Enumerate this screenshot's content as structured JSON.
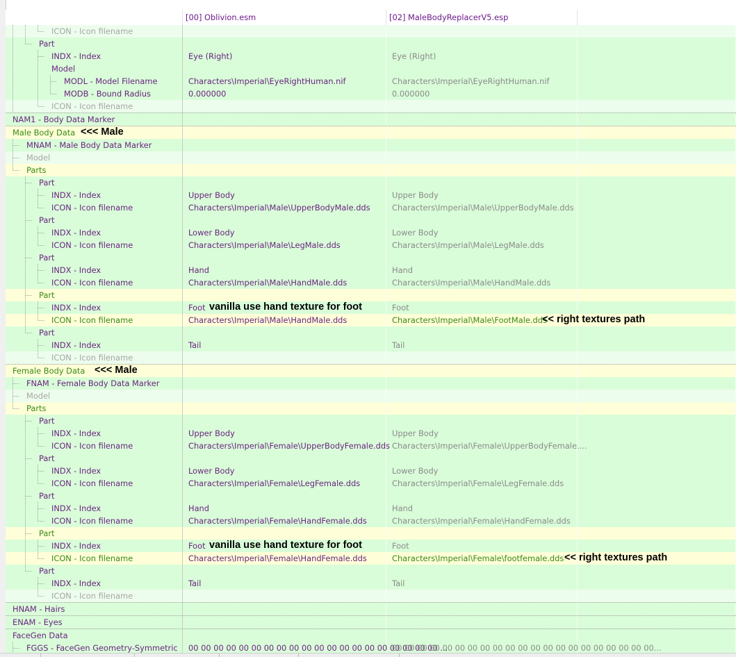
{
  "columns": [
    "",
    "[00] Oblivion.esm",
    "[02] MaleBodyReplacerV5.esp",
    ""
  ],
  "colors": {
    "green_bg": "#d9fdd9",
    "light_green_bg": "#edfded",
    "yellow_bg": "#fefed8",
    "conflict_text": "#3c8a18",
    "field_text": "#6a2480"
  },
  "rows": [
    {
      "depth": 3,
      "label": "ICON - Icon filename",
      "labelStyle": "grey",
      "bg": "lg",
      "lines": [
        1,
        1,
        0
      ],
      "elbow": 1,
      "v1": "",
      "v2": ""
    },
    {
      "depth": 2,
      "label": "Part",
      "labelStyle": "purple",
      "bg": "g",
      "lines": [
        1,
        0
      ],
      "elbow": 1,
      "v1": "",
      "v2": ""
    },
    {
      "depth": 3,
      "label": "INDX - Index",
      "labelStyle": "purple",
      "bg": "g",
      "lines": [
        1,
        0,
        1
      ],
      "elbow": 1,
      "v1": "Eye (Right)",
      "v2": "Eye (Right)"
    },
    {
      "depth": 3,
      "label": "Model",
      "labelStyle": "purple",
      "bg": "g",
      "lines": [
        1,
        0,
        1
      ],
      "elbow": 0,
      "v1": "",
      "v2": ""
    },
    {
      "depth": 4,
      "label": "MODL - Model Filename",
      "labelStyle": "purple",
      "bg": "g",
      "lines": [
        1,
        0,
        1,
        1
      ],
      "elbow": 1,
      "v1": "Characters\\Imperial\\EyeRightHuman.nif",
      "v2": "Characters\\Imperial\\EyeRightHuman.nif"
    },
    {
      "depth": 4,
      "label": "MODB - Bound Radius",
      "labelStyle": "purple",
      "bg": "g",
      "lines": [
        1,
        0,
        1,
        0
      ],
      "elbow": 1,
      "v1": "0.000000",
      "v2": "0.000000"
    },
    {
      "depth": 3,
      "label": "ICON - Icon filename",
      "labelStyle": "grey",
      "bg": "lg",
      "lines": [
        1,
        0,
        0
      ],
      "elbow": 1,
      "v1": "",
      "v2": ""
    },
    {
      "depth": 0,
      "label": "NAM1 - Body Data Marker",
      "labelStyle": "purple",
      "bg": "g",
      "lines": [],
      "elbow": 0,
      "sep": true,
      "v1": "",
      "v2": ""
    },
    {
      "depth": 0,
      "label": "Male Body Data",
      "labelStyle": "green",
      "bg": "y",
      "lines": [],
      "elbow": 0,
      "sep": true,
      "v1": "",
      "v2": "",
      "ann0": "<<< Male"
    },
    {
      "depth": 1,
      "label": "MNAM - Male Body Data Marker",
      "labelStyle": "purple",
      "bg": "g",
      "lines": [
        1
      ],
      "elbow": 1,
      "v1": "",
      "v2": ""
    },
    {
      "depth": 1,
      "label": "Model",
      "labelStyle": "grey",
      "bg": "lg",
      "lines": [
        1
      ],
      "elbow": 1,
      "v1": "",
      "v2": ""
    },
    {
      "depth": 1,
      "label": "Parts",
      "labelStyle": "green",
      "bg": "y",
      "lines": [
        0
      ],
      "elbow": 1,
      "v1": "",
      "v2": ""
    },
    {
      "depth": 2,
      "label": "Part",
      "labelStyle": "purple",
      "bg": "g",
      "lines": [
        0,
        1
      ],
      "elbow": 1,
      "v1": "",
      "v2": ""
    },
    {
      "depth": 3,
      "label": "INDX - Index",
      "labelStyle": "purple",
      "bg": "g",
      "lines": [
        0,
        1,
        1
      ],
      "elbow": 1,
      "v1": "Upper Body",
      "v2": "Upper Body"
    },
    {
      "depth": 3,
      "label": "ICON - Icon filename",
      "labelStyle": "purple",
      "bg": "g",
      "lines": [
        0,
        1,
        0
      ],
      "elbow": 1,
      "v1": "Characters\\Imperial\\Male\\UpperBodyMale.dds",
      "v2": "Characters\\Imperial\\Male\\UpperBodyMale.dds"
    },
    {
      "depth": 2,
      "label": "Part",
      "labelStyle": "purple",
      "bg": "g",
      "lines": [
        0,
        1
      ],
      "elbow": 1,
      "v1": "",
      "v2": ""
    },
    {
      "depth": 3,
      "label": "INDX - Index",
      "labelStyle": "purple",
      "bg": "g",
      "lines": [
        0,
        1,
        1
      ],
      "elbow": 1,
      "v1": "Lower Body",
      "v2": "Lower Body"
    },
    {
      "depth": 3,
      "label": "ICON - Icon filename",
      "labelStyle": "purple",
      "bg": "g",
      "lines": [
        0,
        1,
        0
      ],
      "elbow": 1,
      "v1": "Characters\\Imperial\\Male\\LegMale.dds",
      "v2": "Characters\\Imperial\\Male\\LegMale.dds"
    },
    {
      "depth": 2,
      "label": "Part",
      "labelStyle": "purple",
      "bg": "g",
      "lines": [
        0,
        1
      ],
      "elbow": 1,
      "v1": "",
      "v2": ""
    },
    {
      "depth": 3,
      "label": "INDX - Index",
      "labelStyle": "purple",
      "bg": "g",
      "lines": [
        0,
        1,
        1
      ],
      "elbow": 1,
      "v1": "Hand",
      "v2": "Hand"
    },
    {
      "depth": 3,
      "label": "ICON - Icon filename",
      "labelStyle": "purple",
      "bg": "g",
      "lines": [
        0,
        1,
        0
      ],
      "elbow": 1,
      "v1": "Characters\\Imperial\\Male\\HandMale.dds",
      "v2": "Characters\\Imperial\\Male\\HandMale.dds"
    },
    {
      "depth": 2,
      "label": "Part",
      "labelStyle": "green",
      "bg": "y",
      "lines": [
        0,
        1
      ],
      "elbow": 1,
      "v1": "",
      "v2": ""
    },
    {
      "depth": 3,
      "label": "INDX - Index",
      "labelStyle": "purple",
      "bg": "g",
      "lines": [
        0,
        1,
        1
      ],
      "elbow": 1,
      "v1": "Foot",
      "v2": "Foot",
      "ann1": "vanilla use hand texture for foot"
    },
    {
      "depth": 3,
      "label": "ICON - Icon filename",
      "labelStyle": "green",
      "bg": "y",
      "lines": [
        0,
        1,
        0
      ],
      "elbow": 1,
      "v1": "Characters\\Imperial\\Male\\HandMale.dds",
      "v2": "Characters\\Imperial\\Male\\FootMale.dds",
      "v2Style": "green",
      "ann2": "<< right textures path"
    },
    {
      "depth": 2,
      "label": "Part",
      "labelStyle": "purple",
      "bg": "g",
      "lines": [
        0,
        0
      ],
      "elbow": 1,
      "v1": "",
      "v2": ""
    },
    {
      "depth": 3,
      "label": "INDX - Index",
      "labelStyle": "purple",
      "bg": "g",
      "lines": [
        0,
        0,
        1
      ],
      "elbow": 1,
      "v1": "Tail",
      "v2": "Tail"
    },
    {
      "depth": 3,
      "label": "ICON - Icon filename",
      "labelStyle": "grey",
      "bg": "lg",
      "lines": [
        0,
        0,
        0
      ],
      "elbow": 1,
      "v1": "",
      "v2": ""
    },
    {
      "depth": 0,
      "label": "Female Body Data",
      "labelStyle": "green",
      "bg": "y",
      "lines": [],
      "elbow": 0,
      "sep": true,
      "v1": "",
      "v2": "",
      "ann0": "<<< Male"
    },
    {
      "depth": 1,
      "label": "FNAM - Female Body Data Marker",
      "labelStyle": "purple",
      "bg": "g",
      "lines": [
        1
      ],
      "elbow": 1,
      "v1": "",
      "v2": ""
    },
    {
      "depth": 1,
      "label": "Model",
      "labelStyle": "grey",
      "bg": "lg",
      "lines": [
        1
      ],
      "elbow": 1,
      "v1": "",
      "v2": ""
    },
    {
      "depth": 1,
      "label": "Parts",
      "labelStyle": "green",
      "bg": "y",
      "lines": [
        0
      ],
      "elbow": 1,
      "v1": "",
      "v2": ""
    },
    {
      "depth": 2,
      "label": "Part",
      "labelStyle": "purple",
      "bg": "g",
      "lines": [
        0,
        1
      ],
      "elbow": 1,
      "v1": "",
      "v2": ""
    },
    {
      "depth": 3,
      "label": "INDX - Index",
      "labelStyle": "purple",
      "bg": "g",
      "lines": [
        0,
        1,
        1
      ],
      "elbow": 1,
      "v1": "Upper Body",
      "v2": "Upper Body"
    },
    {
      "depth": 3,
      "label": "ICON - Icon filename",
      "labelStyle": "purple",
      "bg": "g",
      "lines": [
        0,
        1,
        0
      ],
      "elbow": 1,
      "v1": "Characters\\Imperial\\Female\\UpperBodyFemale.dds",
      "v2": "Characters\\Imperial\\Female\\UpperBodyFemale...."
    },
    {
      "depth": 2,
      "label": "Part",
      "labelStyle": "purple",
      "bg": "g",
      "lines": [
        0,
        1
      ],
      "elbow": 1,
      "v1": "",
      "v2": ""
    },
    {
      "depth": 3,
      "label": "INDX - Index",
      "labelStyle": "purple",
      "bg": "g",
      "lines": [
        0,
        1,
        1
      ],
      "elbow": 1,
      "v1": "Lower Body",
      "v2": "Lower Body"
    },
    {
      "depth": 3,
      "label": "ICON - Icon filename",
      "labelStyle": "purple",
      "bg": "g",
      "lines": [
        0,
        1,
        0
      ],
      "elbow": 1,
      "v1": "Characters\\Imperial\\Female\\LegFemale.dds",
      "v2": "Characters\\Imperial\\Female\\LegFemale.dds"
    },
    {
      "depth": 2,
      "label": "Part",
      "labelStyle": "purple",
      "bg": "g",
      "lines": [
        0,
        1
      ],
      "elbow": 1,
      "v1": "",
      "v2": ""
    },
    {
      "depth": 3,
      "label": "INDX - Index",
      "labelStyle": "purple",
      "bg": "g",
      "lines": [
        0,
        1,
        1
      ],
      "elbow": 1,
      "v1": "Hand",
      "v2": "Hand"
    },
    {
      "depth": 3,
      "label": "ICON - Icon filename",
      "labelStyle": "purple",
      "bg": "g",
      "lines": [
        0,
        1,
        0
      ],
      "elbow": 1,
      "v1": "Characters\\Imperial\\Female\\HandFemale.dds",
      "v2": "Characters\\Imperial\\Female\\HandFemale.dds"
    },
    {
      "depth": 2,
      "label": "Part",
      "labelStyle": "green",
      "bg": "y",
      "lines": [
        0,
        1
      ],
      "elbow": 1,
      "v1": "",
      "v2": ""
    },
    {
      "depth": 3,
      "label": "INDX - Index",
      "labelStyle": "purple",
      "bg": "g",
      "lines": [
        0,
        1,
        1
      ],
      "elbow": 1,
      "v1": "Foot",
      "v2": "Foot",
      "ann1": "vanilla use hand texture for foot"
    },
    {
      "depth": 3,
      "label": "ICON - Icon filename",
      "labelStyle": "green",
      "bg": "y",
      "lines": [
        0,
        1,
        0
      ],
      "elbow": 1,
      "v1": "Characters\\Imperial\\Female\\HandFemale.dds",
      "v2": "Characters\\Imperial\\Female\\footfemale.dds",
      "v2Style": "green",
      "ann2": "<< right textures path"
    },
    {
      "depth": 2,
      "label": "Part",
      "labelStyle": "purple",
      "bg": "g",
      "lines": [
        0,
        0
      ],
      "elbow": 1,
      "v1": "",
      "v2": ""
    },
    {
      "depth": 3,
      "label": "INDX - Index",
      "labelStyle": "purple",
      "bg": "g",
      "lines": [
        0,
        0,
        1
      ],
      "elbow": 1,
      "v1": "Tail",
      "v2": "Tail"
    },
    {
      "depth": 3,
      "label": "ICON - Icon filename",
      "labelStyle": "grey",
      "bg": "lg",
      "lines": [
        0,
        0,
        0
      ],
      "elbow": 1,
      "v1": "",
      "v2": ""
    },
    {
      "depth": 0,
      "label": "HNAM - Hairs",
      "labelStyle": "purple",
      "bg": "g",
      "lines": [],
      "elbow": 0,
      "sep": true,
      "v1": "",
      "v2": ""
    },
    {
      "depth": 0,
      "label": "ENAM - Eyes",
      "labelStyle": "purple",
      "bg": "g",
      "lines": [],
      "elbow": 0,
      "sep": true,
      "v1": "",
      "v2": ""
    },
    {
      "depth": 0,
      "label": "FaceGen Data",
      "labelStyle": "purple",
      "bg": "g",
      "lines": [],
      "elbow": 0,
      "sep": true,
      "v1": "",
      "v2": ""
    },
    {
      "depth": 1,
      "label": "FGGS - FaceGen Geometry-Symmetric",
      "labelStyle": "purple",
      "bg": "g",
      "lines": [
        1
      ],
      "elbow": 1,
      "v1": "00 00 00 00 00 00 00 00 00 00 00 00 00 00 00 00 00 00 00 00 ...",
      "v2": "00 00 00 00 00 00 00 00 00 00 00 00 00 00 00 00 00 00 00 00 00..."
    }
  ]
}
